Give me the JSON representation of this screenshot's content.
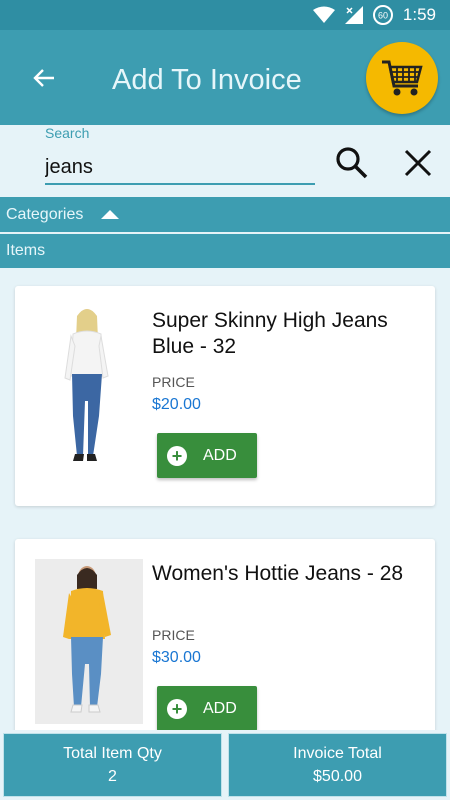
{
  "status_bar": {
    "time": "1:59",
    "battery_level": "60"
  },
  "app_bar": {
    "title": "Add To Invoice"
  },
  "search": {
    "label": "Search",
    "value": "jeans"
  },
  "sections": {
    "categories": "Categories",
    "items": "Items"
  },
  "products": [
    {
      "name": "Super Skinny High Jeans Blue - 32",
      "price_label": "PRICE",
      "price": "$20.00",
      "add_label": "ADD"
    },
    {
      "name": "Women's Hottie Jeans - 28",
      "price_label": "PRICE",
      "price": "$30.00",
      "add_label": "ADD"
    }
  ],
  "footer": {
    "qty_label": "Total Item Qty",
    "qty_value": "2",
    "total_label": "Invoice Total",
    "total_value": "$50.00"
  },
  "colors": {
    "primary": "#3d9db1",
    "accent": "#f5b900",
    "add_button": "#388e3c",
    "price": "#1976d2"
  }
}
